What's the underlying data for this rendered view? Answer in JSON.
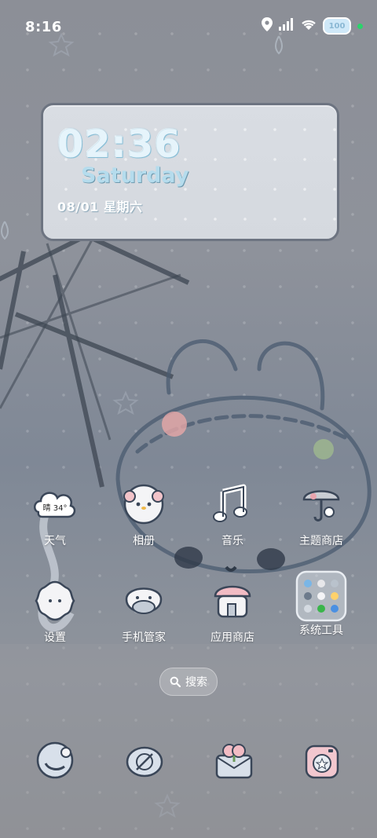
{
  "status_bar": {
    "time": "8:16",
    "battery_level": "100",
    "icons": [
      "location-icon",
      "signal-icon",
      "wifi-icon",
      "battery-icon",
      "privacy-dot-icon"
    ]
  },
  "clock_widget": {
    "time": "02:36",
    "day": "Saturday",
    "date": "08/01  星期六"
  },
  "apps": [
    {
      "label": "天气",
      "icon": "weather-icon",
      "badge": "晴 34°"
    },
    {
      "label": "相册",
      "icon": "gallery-icon"
    },
    {
      "label": "音乐",
      "icon": "music-icon"
    },
    {
      "label": "主题商店",
      "icon": "theme-store-icon"
    },
    {
      "label": "设置",
      "icon": "settings-icon"
    },
    {
      "label": "手机管家",
      "icon": "phone-manager-icon"
    },
    {
      "label": "应用商店",
      "icon": "app-store-icon"
    },
    {
      "label": "系统工具",
      "icon": "system-tools-folder-icon"
    }
  ],
  "search": {
    "label": "搜索"
  },
  "dock": [
    {
      "icon": "phone-icon"
    },
    {
      "icon": "messages-icon"
    },
    {
      "icon": "browser-icon"
    },
    {
      "icon": "camera-icon"
    }
  ],
  "colors": {
    "accent": "#b5dced",
    "privacy_dot": "#2bd36b"
  }
}
